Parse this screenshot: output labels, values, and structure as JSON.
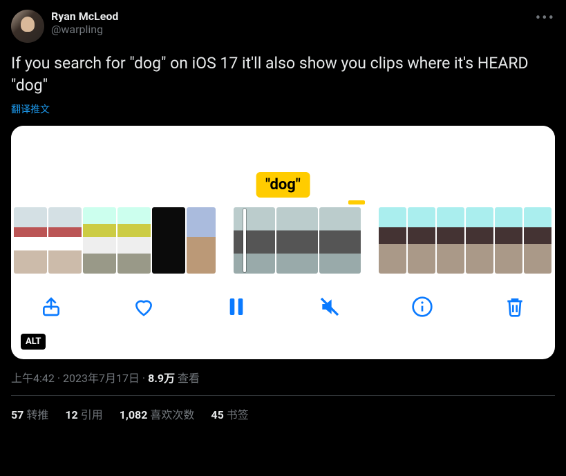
{
  "author": {
    "display_name": "Ryan McLeod",
    "handle": "@warpling"
  },
  "tweet_text": "If you search for \"dog\" on iOS 17 it'll also show you clips where it's HEARD \"dog\"",
  "translate_label": "翻译推文",
  "media": {
    "search_chip": "\"dog\"",
    "alt_badge": "ALT",
    "toolbar_icons": {
      "share": "share-icon",
      "like": "heart-icon",
      "pause": "pause-icon",
      "mute": "speaker-muted-icon",
      "info": "info-icon",
      "delete": "trash-icon"
    }
  },
  "meta": {
    "time": "上午4:42",
    "date": "2023年7月17日",
    "views_count": "8.9万",
    "views_label": "查看"
  },
  "stats": {
    "retweets_count": "57",
    "retweets_label": "转推",
    "quotes_count": "12",
    "quotes_label": "引用",
    "likes_count": "1,082",
    "likes_label": "喜欢次数",
    "bookmarks_count": "45",
    "bookmarks_label": "书签"
  }
}
